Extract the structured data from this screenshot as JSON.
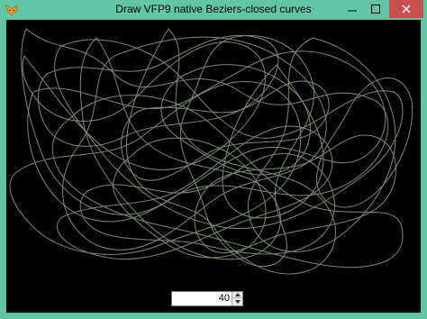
{
  "window": {
    "title": "Draw VFP9 native Beziers-closed curves",
    "icon": "fox-app-icon",
    "controls": {
      "minimize_icon": "minimize-icon",
      "maximize_icon": "maximize-icon",
      "close_icon": "close-icon"
    }
  },
  "canvas": {
    "background": "#000000",
    "stroke_color": "#7d8a72"
  },
  "spinner": {
    "value": "40",
    "up_icon": "spin-up-icon",
    "down_icon": "spin-down-icon"
  },
  "colors": {
    "frame": "#62c6a6",
    "close_button": "#c7504f"
  }
}
